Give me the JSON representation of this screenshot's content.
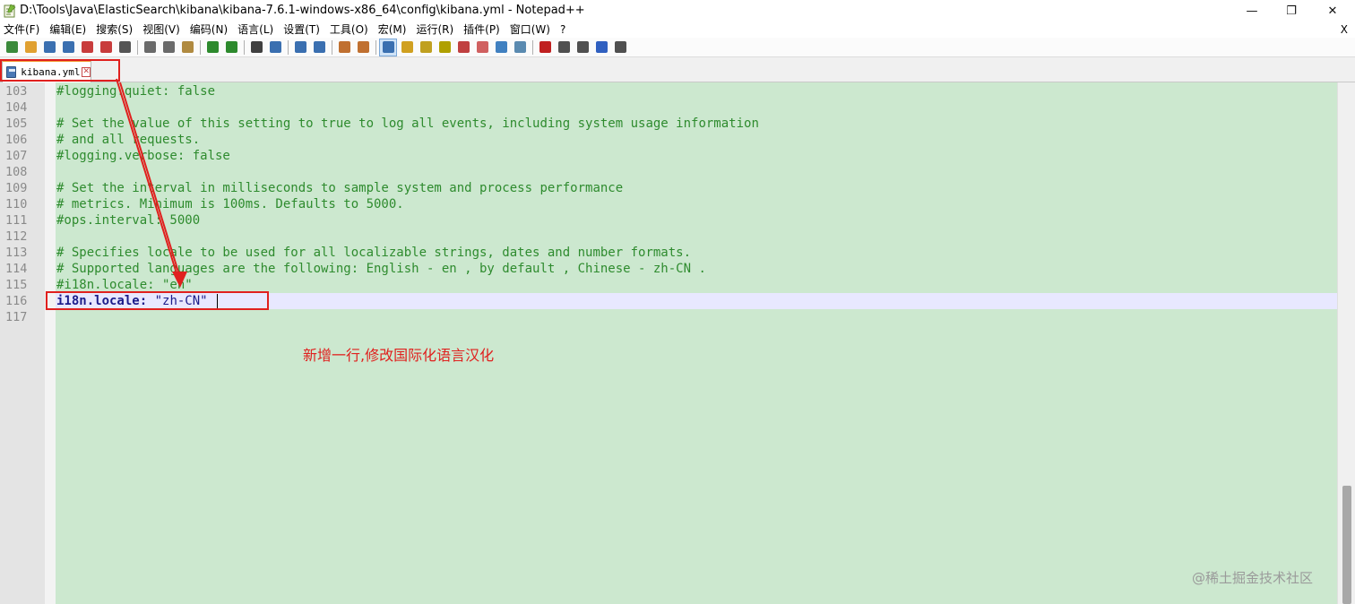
{
  "window": {
    "title": "D:\\Tools\\Java\\ElasticSearch\\kibana\\kibana-7.6.1-windows-x86_64\\config\\kibana.yml - Notepad++",
    "minimize": "—",
    "maximize": "❐",
    "close": "✕"
  },
  "menu": {
    "items": [
      "文件(F)",
      "编辑(E)",
      "搜索(S)",
      "视图(V)",
      "编码(N)",
      "语言(L)",
      "设置(T)",
      "工具(O)",
      "宏(M)",
      "运行(R)",
      "插件(P)",
      "窗口(W)",
      "?"
    ],
    "close": "X"
  },
  "toolbar": {
    "icons": [
      "new-file-icon",
      "open-file-icon",
      "save-icon",
      "save-all-icon",
      "close-icon",
      "close-all-icon",
      "print-icon",
      "|",
      "cut-icon",
      "copy-icon",
      "paste-icon",
      "|",
      "undo-icon",
      "redo-icon",
      "|",
      "find-icon",
      "replace-icon",
      "|",
      "zoom-in-icon",
      "zoom-out-icon",
      "|",
      "sync-vertical-icon",
      "sync-horizontal-icon",
      "|",
      "word-wrap-icon",
      "show-all-chars-icon",
      "indent-guide-icon",
      "document-map-icon",
      "function-list-icon",
      "folder-workspace-icon",
      "monitoring-icon",
      "eye-icon",
      "|",
      "record-macro-icon",
      "stop-macro-icon",
      "play-macro-icon",
      "play-multiple-icon",
      "save-macro-icon"
    ],
    "colors": [
      "#3b8a3b",
      "#e0a030",
      "#3a6fb0",
      "#3a6fb0",
      "#c83c3c",
      "#c83c3c",
      "#555555",
      "",
      "#6a6a6a",
      "#6a6a6a",
      "#b08a40",
      "",
      "#2d8a2d",
      "#2d8a2d",
      "",
      "#404040",
      "#3a6fb0",
      "",
      "#3a6fb0",
      "#3a6fb0",
      "",
      "#c07030",
      "#c07030",
      "",
      "#3a6fb0",
      "#d0a020",
      "#c0a020",
      "#b0a000",
      "#c04040",
      "#d06060",
      "#4080c0",
      "#5a8ab0",
      "",
      "#c02020",
      "#505050",
      "#505050",
      "#3060c0",
      "#505050"
    ]
  },
  "tab": {
    "label": "kibana.yml",
    "close": "✕"
  },
  "lines": [
    {
      "num": "103",
      "text": "#logging.quiet: false"
    },
    {
      "num": "104",
      "text": ""
    },
    {
      "num": "105",
      "text": "# Set the value of this setting to true to log all events, including system usage information"
    },
    {
      "num": "106",
      "text": "# and all requests."
    },
    {
      "num": "107",
      "text": "#logging.verbose: false"
    },
    {
      "num": "108",
      "text": ""
    },
    {
      "num": "109",
      "text": "# Set the interval in milliseconds to sample system and process performance"
    },
    {
      "num": "110",
      "text": "# metrics. Minimum is 100ms. Defaults to 5000."
    },
    {
      "num": "111",
      "text": "#ops.interval: 5000"
    },
    {
      "num": "112",
      "text": ""
    },
    {
      "num": "113",
      "text": "# Specifies locale to be used for all localizable strings, dates and number formats."
    },
    {
      "num": "114",
      "text": "# Supported languages are the following: English - en , by default , Chinese - zh-CN ."
    },
    {
      "num": "115",
      "text": "#i18n.locale: \"en\""
    },
    {
      "num": "116",
      "key": "i18n.locale:",
      "value": " \"zh-CN\""
    },
    {
      "num": "117",
      "text": ""
    }
  ],
  "annotation": {
    "text": "新增一行,修改国际化语言汉化",
    "color": "#e0201e"
  },
  "watermark": "@稀土掘金技术社区"
}
